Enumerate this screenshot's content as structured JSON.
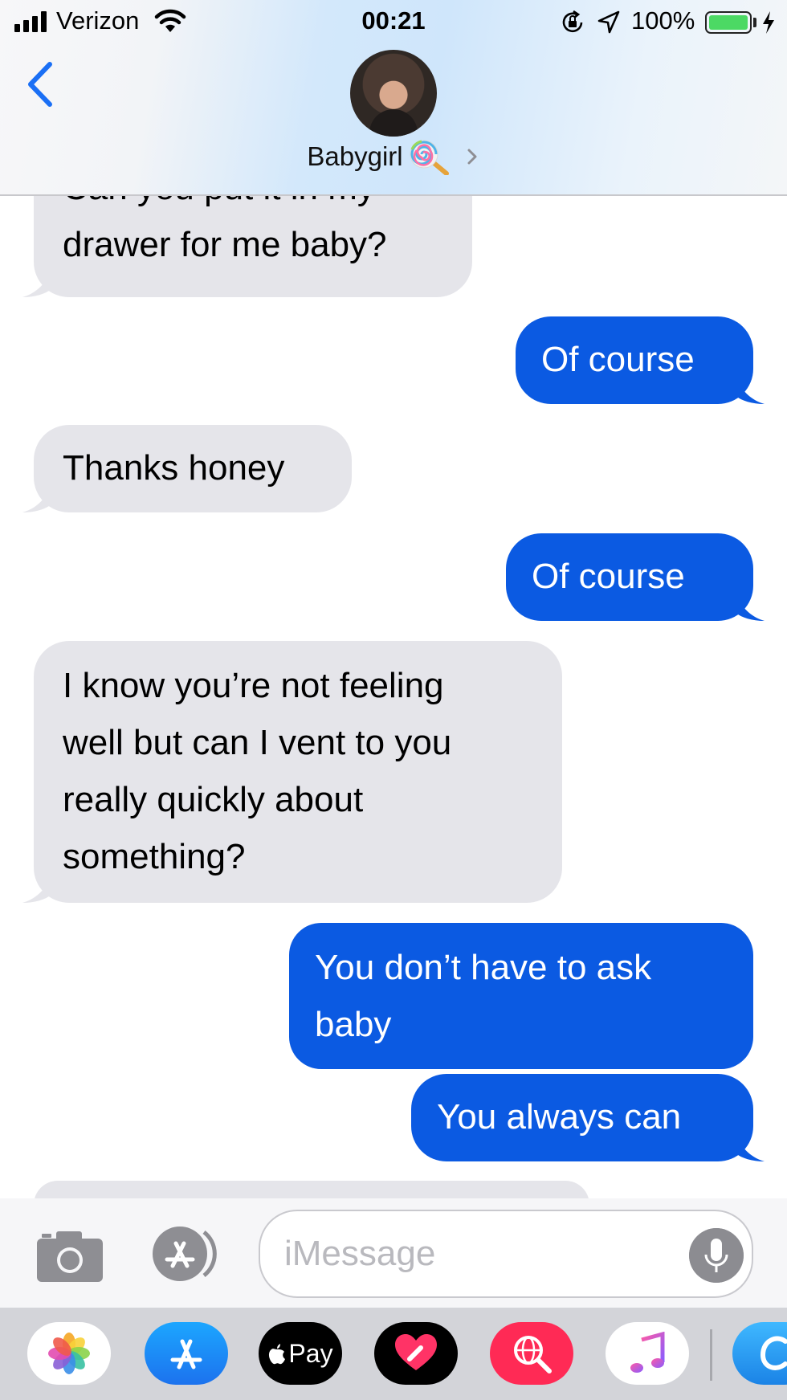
{
  "status_bar": {
    "carrier": "Verizon",
    "time": "00:21",
    "battery_percent": "100%",
    "battery_level": 1.0,
    "battery_color": "#4cd964",
    "icons": [
      "signal-icon",
      "wifi-icon",
      "orientation-lock-icon",
      "location-arrow-icon",
      "battery-icon",
      "charging-bolt-icon"
    ]
  },
  "header": {
    "back_icon": "chevron-left-icon",
    "contact_name": "Babygirl",
    "contact_emoji": "lollipop-icon",
    "detail_icon": "chevron-right-icon"
  },
  "messages": [
    {
      "direction": "incoming",
      "lines": [
        "Can you put it in my",
        "drawer for me baby?"
      ],
      "partially_hidden": true
    },
    {
      "direction": "outgoing",
      "lines": [
        "Of course"
      ]
    },
    {
      "direction": "incoming",
      "lines": [
        "Thanks honey"
      ]
    },
    {
      "direction": "outgoing",
      "lines": [
        "Of course"
      ]
    },
    {
      "direction": "incoming",
      "lines": [
        "I know you’re not feeling",
        "well but can I vent to you",
        "really quickly about",
        "something?"
      ]
    },
    {
      "direction": "outgoing",
      "lines": [
        "You don’t have to ask",
        "baby"
      ]
    },
    {
      "direction": "outgoing",
      "lines": [
        "You always can"
      ]
    }
  ],
  "compose": {
    "placeholder": "iMessage",
    "value": "",
    "camera_icon": "camera-icon",
    "apps_icon": "app-store-icon",
    "mic_icon": "microphone-icon"
  },
  "app_drawer": {
    "apps": [
      {
        "name": "photos-app-icon"
      },
      {
        "name": "app-store-app-icon"
      },
      {
        "name": "apple-pay-app-icon",
        "label": "Pay"
      },
      {
        "name": "digital-touch-app-icon"
      },
      {
        "name": "images-search-app-icon"
      },
      {
        "name": "music-app-icon"
      },
      {
        "name": "extra-app-icon"
      }
    ]
  },
  "colors": {
    "outgoing_bubble": "#0b5ae2",
    "incoming_bubble": "#e5e5ea",
    "accent": "#1a6ff5"
  }
}
